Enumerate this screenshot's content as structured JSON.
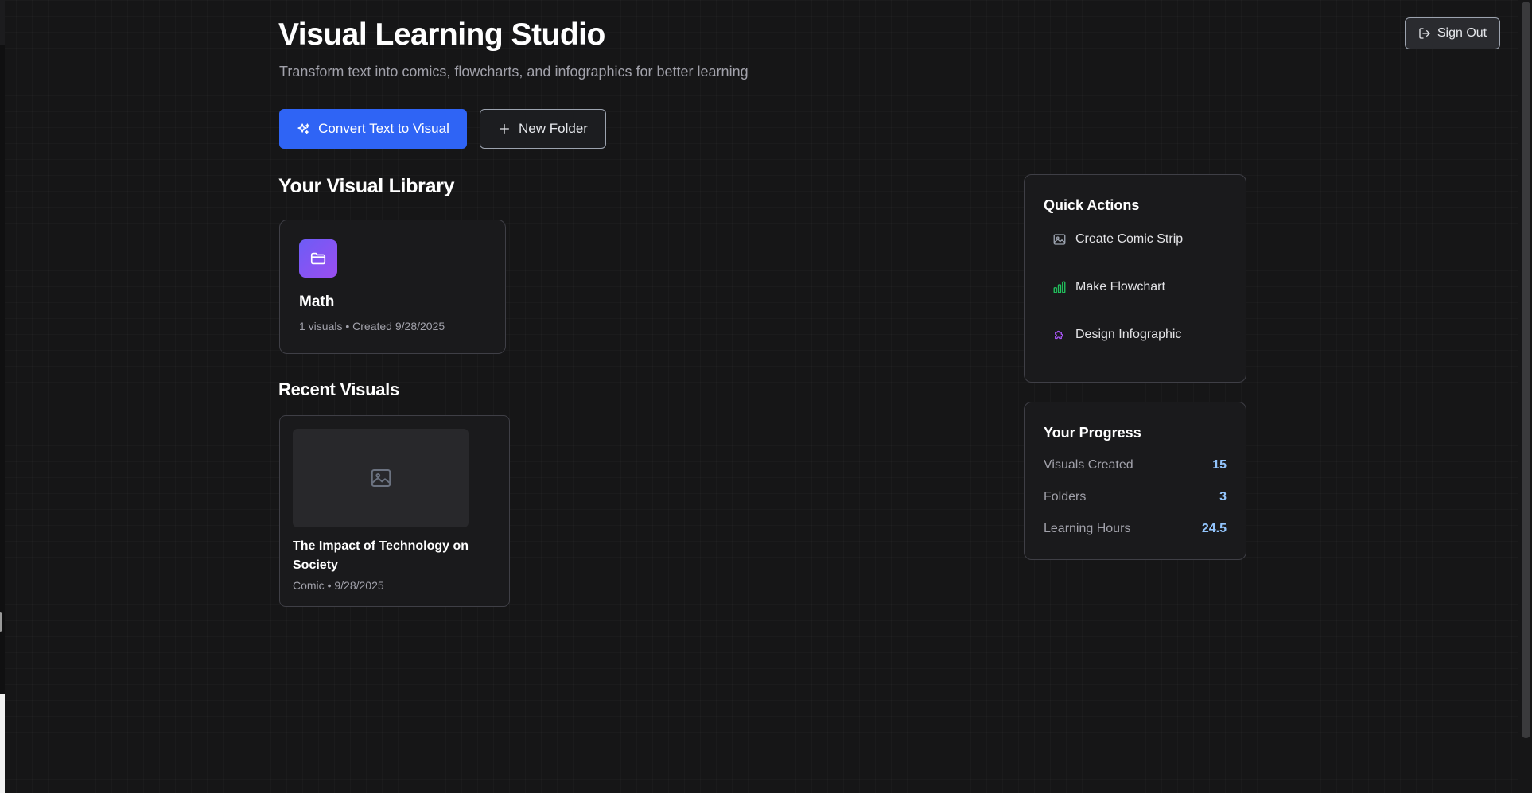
{
  "header": {
    "title": "Visual Learning Studio",
    "subtitle": "Transform text into comics, flowcharts, and infographics for better learning",
    "sign_out_label": "Sign Out"
  },
  "toolbar": {
    "convert_label": "Convert Text to Visual",
    "new_folder_label": "New Folder"
  },
  "library": {
    "heading": "Your Visual Library",
    "folders": [
      {
        "name": "Math",
        "visual_count": "1 visuals",
        "separator": "•",
        "created": "Created 9/28/2025",
        "icon": "folder-icon"
      }
    ]
  },
  "recent": {
    "heading": "Recent Visuals",
    "items": [
      {
        "title": "The Impact of Technology on Society",
        "type": "Comic",
        "separator": "•",
        "date": "9/28/2025",
        "thumbnail_icon": "image-placeholder-icon"
      }
    ]
  },
  "quick_actions": {
    "heading": "Quick Actions",
    "items": [
      {
        "label": "Create Comic Strip",
        "icon": "image-icon",
        "color": "#9ca3af"
      },
      {
        "label": "Make Flowchart",
        "icon": "bar-chart-icon",
        "color": "#22c55e"
      },
      {
        "label": "Design Infographic",
        "icon": "puzzle-icon",
        "color": "#a855f7"
      }
    ]
  },
  "progress": {
    "heading": "Your Progress",
    "stats": [
      {
        "label": "Visuals Created",
        "value": "15"
      },
      {
        "label": "Folders",
        "value": "3"
      },
      {
        "label": "Learning Hours",
        "value": "24.5"
      }
    ]
  },
  "colors": {
    "background": "#161617",
    "primary_accent": "#2f64f5",
    "folder_gradient_start": "#6d5cf6",
    "folder_gradient_end": "#9b4ef0",
    "stat_value": "#93c5fd"
  }
}
